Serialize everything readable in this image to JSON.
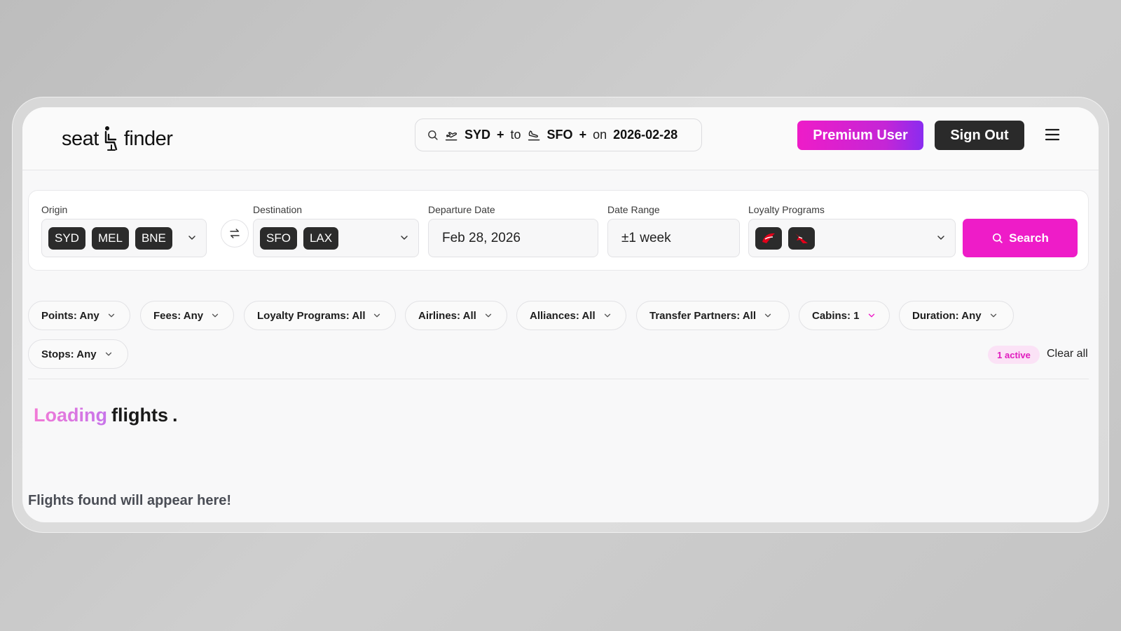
{
  "header": {
    "logo_left": "seat",
    "logo_right": "finder",
    "search_summary": {
      "origin": "SYD",
      "plus1": "+",
      "to": "to",
      "destination": "SFO",
      "plus2": "+",
      "on": "on",
      "date": "2026-02-28"
    },
    "premium_label": "Premium User",
    "signout_label": "Sign Out"
  },
  "search_form": {
    "origin": {
      "label": "Origin",
      "chips": [
        "SYD",
        "MEL",
        "BNE"
      ]
    },
    "destination": {
      "label": "Destination",
      "chips": [
        "SFO",
        "LAX"
      ]
    },
    "departure_date": {
      "label": "Departure Date",
      "value": "Feb 28, 2026"
    },
    "date_range": {
      "label": "Date Range",
      "value": "±1 week"
    },
    "loyalty_programs": {
      "label": "Loyalty Programs",
      "logos": [
        "virgin-australia-logo",
        "qantas-logo"
      ]
    },
    "search_label": "Search"
  },
  "filters": {
    "items": [
      "Points: Any",
      "Fees: Any",
      "Loyalty Programs: All",
      "Airlines: All",
      "Alliances: All",
      "Transfer Partners: All",
      "Cabins: 1",
      "Duration: Any",
      "Stops: Any"
    ],
    "active_badge": "1 active",
    "clear_all": "Clear all"
  },
  "results": {
    "loading_word": "Loading",
    "loading_rest": "flights",
    "loading_dot": ".",
    "empty_message": "Flights found will appear here!"
  },
  "colors": {
    "accent": "#ee1cc8",
    "dark": "#2b2b2b"
  }
}
